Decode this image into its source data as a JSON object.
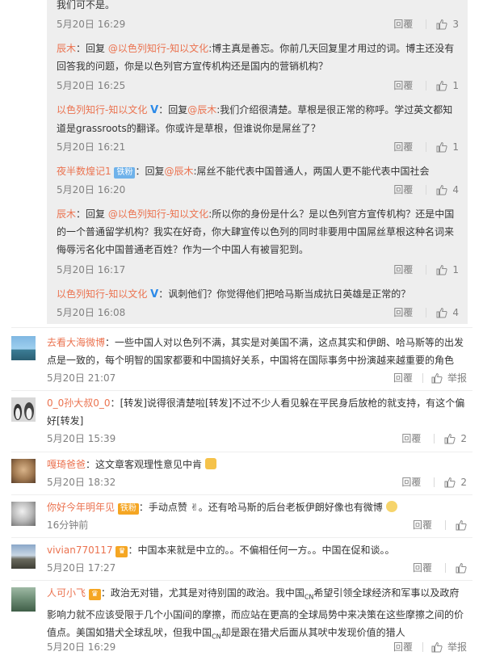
{
  "nested_replies": [
    {
      "text": "我们可不是。",
      "time": "5月20日 16:29",
      "reply_label": "回覆",
      "likes": "3"
    },
    {
      "user": "辰木",
      "sep": "：回复 ",
      "mention": "@以色列知行-知以文化",
      "text1": ":博主真是善忘。你前几天回复里才用过的词。博主还没有",
      "text2": "回答我的问题，你是以色列官方宣传机构还是国内的营销机构？",
      "time": "5月20日 16:25",
      "reply_label": "回覆",
      "likes": "1"
    },
    {
      "user": "以色列知行-知以文化",
      "v": "V",
      "sep": "：回复",
      "mention": "@辰木",
      "text1": ":我们介绍很清楚。草根是很正常的称呼。学过英文都知",
      "text2": "道是grassroots的翻译。你或许是草根，但谁说你是屌丝了？",
      "time": "5月20日 16:21",
      "reply_label": "回覆",
      "likes": "1"
    },
    {
      "user": "夜半数煌记1",
      "badge": "铁粉",
      "sep": "：回复",
      "mention": "@辰木",
      "text1": ":屌丝不能代表中国普通人，两国人更不能代表中国社会",
      "time": "5月20日 16:20",
      "reply_label": "回覆",
      "likes": "4"
    },
    {
      "user": "辰木",
      "sep": "：回复 ",
      "mention": "@以色列知行-知以文化",
      "text1": ":所以你的身份是什么？是以色列官方宣传机构？还是中国",
      "text2": "的一个普通留学机构？我实在好奇，你大肆宣传以色列的同时非要用中国屌丝草根这种名词来",
      "text3": "侮辱污名化中国普通老百姓？作为一个中国人有被冒犯到。",
      "time": "5月20日 16:17",
      "reply_label": "回覆",
      "likes": "1"
    },
    {
      "user": "以色列知行-知以文化",
      "v": "V",
      "sep": "：",
      "text1": "讽刺他们？你觉得他们把哈马斯当成抗日英雄是正常的？",
      "time": "5月20日 16:08",
      "reply_label": "回覆",
      "likes": "4"
    }
  ],
  "comments": [
    {
      "user": "去看大海微博",
      "sep": "：",
      "text1": "一些中国人对以色列不满，其实是对美国不满，这点其实和伊朗、哈马斯等的出发",
      "text2": "点是一致的，每个明智的国家都要和中国搞好关系，中国将在国际事务中扮演越来越重要的角色",
      "time": "5月20日 21:07",
      "reply_label": "回覆",
      "report_label": "举报"
    },
    {
      "user": "0_0孙大叔0_0",
      "sep": "：",
      "text1": "[转发]说得很清楚啦[转发]不过不少人看见躲在平民身后放枪的就支持，有这个偏",
      "text2": "好[转发]",
      "time": "5月20日 15:39",
      "reply_label": "回覆",
      "likes": "2"
    },
    {
      "user": "嘎琦爸爸",
      "sep": "：",
      "text1": "这文章客观理性意见中肯",
      "time": "5月20日 18:32",
      "reply_label": "回覆",
      "likes": "2"
    },
    {
      "user": "你好今年明年见",
      "badge": "铁粉",
      "sep": "：",
      "text1": "手动点赞",
      "text1b": "。还有哈马斯的后台老板伊朗好像也有微博",
      "time": "16分钟前",
      "reply_label": "回覆"
    },
    {
      "user": "vivian770117",
      "sep": "：",
      "text1": "中国本来就是中立的。。不偏相任何一方。。中国在促和谈。。",
      "time": "5月20日 17:27",
      "reply_label": "回覆"
    },
    {
      "user": "人可小飞",
      "sep": "：",
      "text1": "政治无对错，尤其是对待别国的政治。我中国",
      "cn": "CN",
      "text1b": "希望引领全球经济和军事以及政府",
      "text2": "影响力就不应该受限于几个小国间的摩擦，而应站在更高的全球局势中来决策在这些摩擦之间的价",
      "text3": "值点。美国如猎犬全球乱吠，但我中国",
      "text3b": "却是跟在猎犬后面从其吠中发现价值的猎人",
      "time": "5月20日 16:29",
      "reply_label": "回覆",
      "report_label": "举报"
    }
  ],
  "colors": {
    "link": "#eb7350",
    "nested_bg": "#eeeeee",
    "meta": "#808080",
    "verified": "#2c8ae8"
  }
}
